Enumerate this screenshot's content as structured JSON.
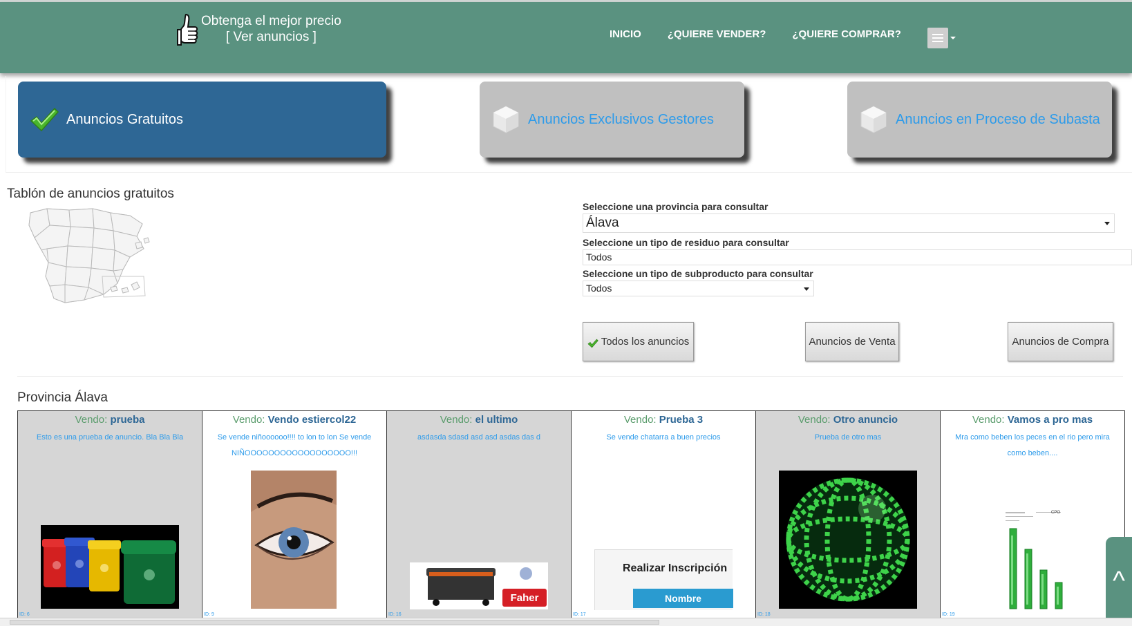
{
  "header": {
    "brand_line1": "Obtenga el mejor precio",
    "brand_line2": "[ Ver anuncios ]",
    "nav": [
      "INICIO",
      "¿QUIERE VENDER?",
      "¿QUIERE COMPRAR?"
    ],
    "menu_icon": "hamburger-icon",
    "colors": {
      "header_bg": "#5a9280",
      "active_tab": "#2e6795",
      "inactive_tab": "#c0c0c0",
      "link_blue": "#2d9bea"
    }
  },
  "tabs": [
    {
      "label": "Anuncios Gratuitos",
      "active": true,
      "icon": "checkmark-icon"
    },
    {
      "label": "Anuncios Exclusivos Gestores",
      "active": false,
      "icon": "cube-icon"
    },
    {
      "label": "Anuncios en Proceso de Subasta",
      "active": false,
      "icon": "cube-icon"
    }
  ],
  "board": {
    "title": "Tablón de anuncios gratuitos",
    "province_label": "Seleccione una provincia para consultar",
    "province_value": "Álava",
    "residue_label": "Seleccione un tipo de residuo para consultar",
    "residue_value": "Todos",
    "subproduct_label": "Seleccione un tipo de subproducto para consultar",
    "subproduct_value": "Todos",
    "filters": [
      "Todos los anuncios",
      "Anuncios de Venta",
      "Anuncios de Compra"
    ],
    "active_filter": "Todos los anuncios"
  },
  "province_title": "Provincia Álava",
  "cards": [
    {
      "prefix": "Vendo:",
      "title": "prueba",
      "desc": "Esto es una prueba de anuncio. Bla Bla Bla",
      "id": "ID: 6",
      "image": "recycling-bins"
    },
    {
      "prefix": "Vendo:",
      "title": "Vendo estiercol22",
      "desc": "Se vende niñoooooo!!!! to lon to lon Se vende NIÑOOOOOOOOOOOOOOOOOO!!!",
      "id": "ID: 9",
      "image": "blue-eye"
    },
    {
      "prefix": "Vendo:",
      "title": "el ultimo",
      "desc": "asdasda sdasd asd asd asdas das d",
      "id": "ID: 16",
      "image": "cart-and-logo"
    },
    {
      "prefix": "Vendo:",
      "title": "Prueba 3",
      "desc": "Se vende chatarra a buen precios",
      "id": "ID: 17",
      "image": "form-screenshot",
      "image_text": "Realizar Inscripción",
      "image_button": "Nombre"
    },
    {
      "prefix": "Vendo:",
      "title": "Otro anuncio",
      "desc": "Prueba de otro mas",
      "id": "ID: 18",
      "image": "binary-globe"
    },
    {
      "prefix": "Vendo:",
      "title": "Vamos a pro mas",
      "desc": "Mra como beben los peces en el rio pero mira como beben....",
      "id": "ID: 19",
      "image": "bar-chart-image"
    }
  ],
  "scroll_top_symbol": "^"
}
